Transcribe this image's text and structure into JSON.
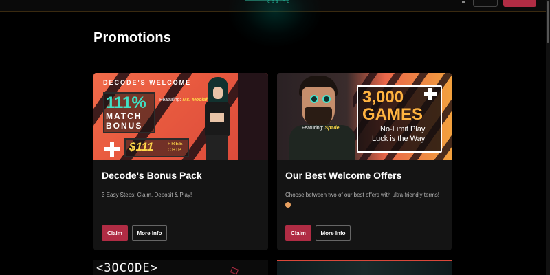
{
  "header": {
    "logo_sub": "casino"
  },
  "page": {
    "title": "Promotions"
  },
  "promotions": [
    {
      "banner": {
        "heading": "DECODE'S WELCOME",
        "percent": "111%",
        "match": "MATCH",
        "bonus": "BONUS",
        "featuring_label": "Featuring:",
        "featuring_name": "Ms. Moolah",
        "chip_amount": "$111",
        "chip_label": "FREE CHIP"
      },
      "title": "Decode's Bonus Pack",
      "description": "3 Easy Steps: Claim, Deposit & Play!",
      "claim_label": "Claim",
      "more_label": "More Info"
    },
    {
      "banner": {
        "number": "3,000",
        "games": "GAMES",
        "line1": "No-Limit Play",
        "line2": "Luck is the Way",
        "featuring_label": "Featuring:",
        "featuring_name": "Spade"
      },
      "title": "Our Best Welcome Offers",
      "description": "Choose between two of our best offers with ultra-friendly terms!",
      "claim_label": "Claim",
      "more_label": "More Info"
    }
  ],
  "bottom_cards": [
    {
      "banner_text": "<3OCODE>"
    }
  ],
  "colors": {
    "accent": "#b02c44",
    "card_bg": "#141414",
    "page_bg": "#000000"
  }
}
